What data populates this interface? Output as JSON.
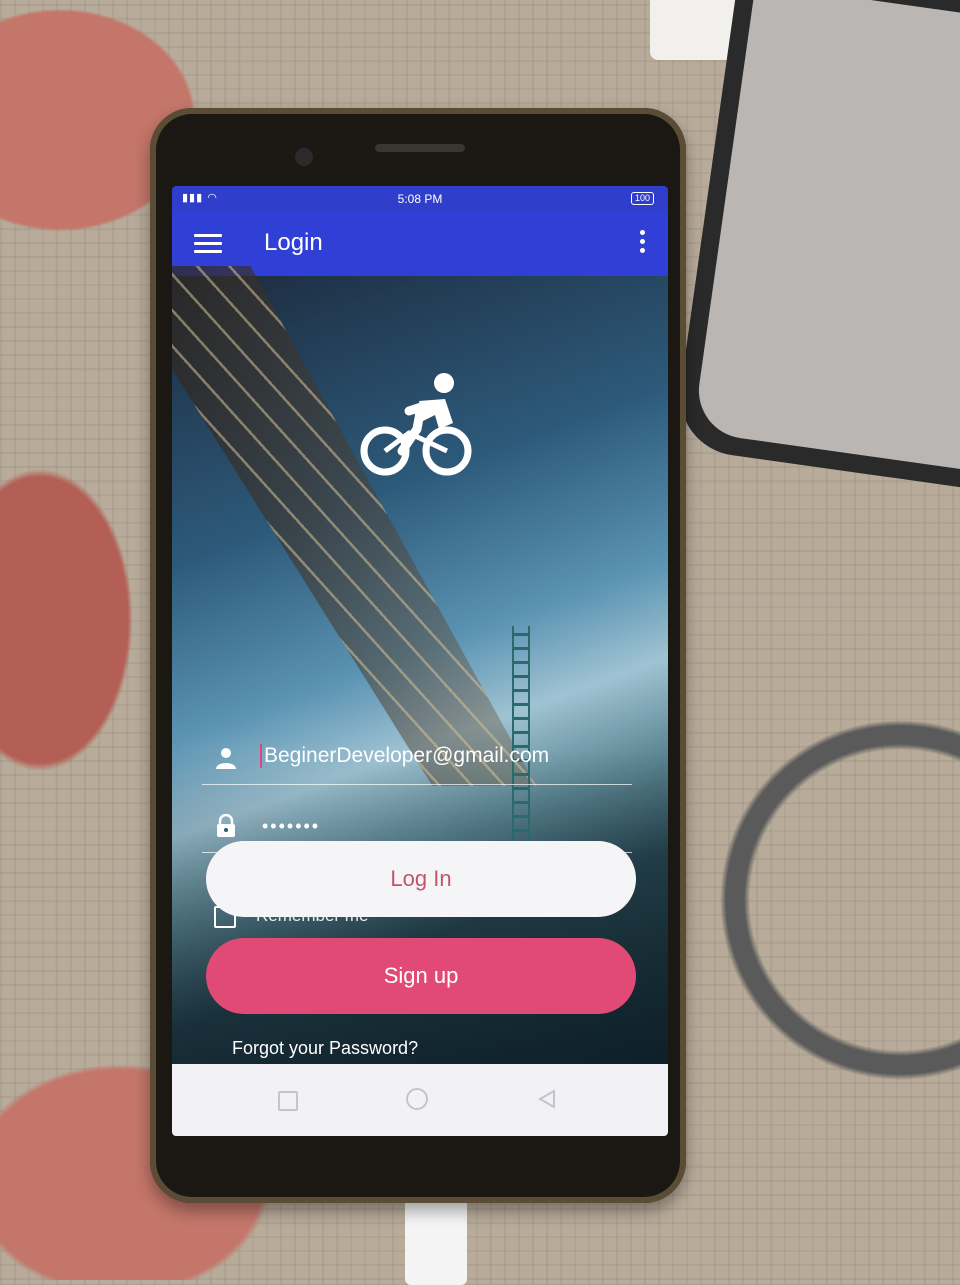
{
  "status_bar": {
    "signal": "□□□ •",
    "time": "5:08 PM",
    "battery": "100"
  },
  "app_bar": {
    "title": "Login"
  },
  "logo": {
    "icon": "bicycle-rider-icon"
  },
  "form": {
    "email_value": "BeginerDeveloper@gmail.com",
    "password_value": "•••••••",
    "remember_label": "Remember me",
    "login_label": "Log In",
    "signup_label": "Sign up",
    "forgot_label": "Forgot your Password?"
  },
  "colors": {
    "app_bar": "#3040d6",
    "accent": "#e04a74",
    "login_text": "#c0576c"
  }
}
